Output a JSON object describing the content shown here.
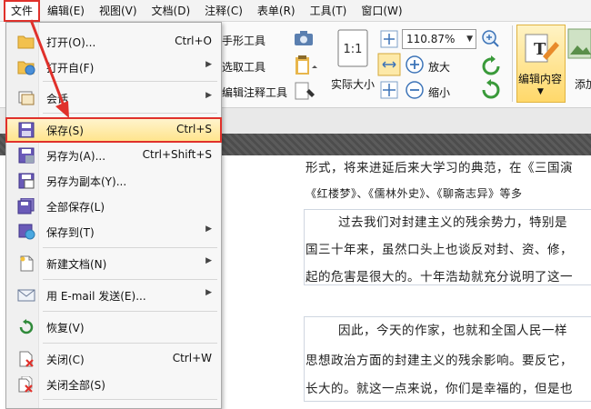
{
  "menubar": {
    "items": [
      "文件",
      "编辑(E)",
      "视图(V)",
      "文档(D)",
      "注释(C)",
      "表单(R)",
      "工具(T)",
      "窗口(W)"
    ]
  },
  "toolbar": {
    "hand_tool": "手形工具",
    "select_tool": "选取工具",
    "edit_annotation_tool": "编辑注释工具",
    "actual_size": "实际大小",
    "zoom_value": "110.87%",
    "zoom_in": "放大",
    "zoom_out": "缩小",
    "edit_content": "编辑内容",
    "add": "添加",
    "actual_size_glyph": "1:1"
  },
  "file_menu": {
    "items": [
      {
        "label": "打开(O)...",
        "shortcut": "Ctrl+O",
        "submenu": false
      },
      {
        "label": "打开自(F)",
        "shortcut": "",
        "submenu": true
      },
      {
        "label": "会话",
        "shortcut": "",
        "submenu": true
      },
      {
        "label": "保存(S)",
        "shortcut": "Ctrl+S",
        "submenu": false
      },
      {
        "label": "另存为(A)...",
        "shortcut": "Ctrl+Shift+S",
        "submenu": false
      },
      {
        "label": "另存为副本(Y)...",
        "shortcut": "",
        "submenu": false
      },
      {
        "label": "全部保存(L)",
        "shortcut": "",
        "submenu": false
      },
      {
        "label": "保存到(T)",
        "shortcut": "",
        "submenu": true
      },
      {
        "label": "新建文档(N)",
        "shortcut": "",
        "submenu": true
      },
      {
        "label": "用 E-mail 发送(E)...",
        "shortcut": "",
        "submenu": true
      },
      {
        "label": "恢复(V)",
        "shortcut": "",
        "submenu": false
      },
      {
        "label": "关闭(C)",
        "shortcut": "Ctrl+W",
        "submenu": false
      },
      {
        "label": "关闭全部(S)",
        "shortcut": "",
        "submenu": false
      }
    ],
    "submenu_glyph": "▶"
  },
  "document": {
    "lines": [
      "形式，将来进延后来大学习的典范，在《三国演",
      "《红楼梦》、《儒林外史》、《聊斋志异》等多",
      "过去我们对封建主义的残余势力，特别是",
      "国三十年来，虽然口头上也谈反对封、资、修，",
      "起的危害是很大的。十年浩劫就充分说明了这一",
      "因此，今天的作家，也就和全国人民一样",
      "思想政治方面的封建主义的残余影响。要反它，",
      "长大的。就这一点来说，你们是幸福的，但是也"
    ]
  },
  "colors": {
    "highlight": "#e0312b",
    "selected_item": "#ffe48a"
  }
}
